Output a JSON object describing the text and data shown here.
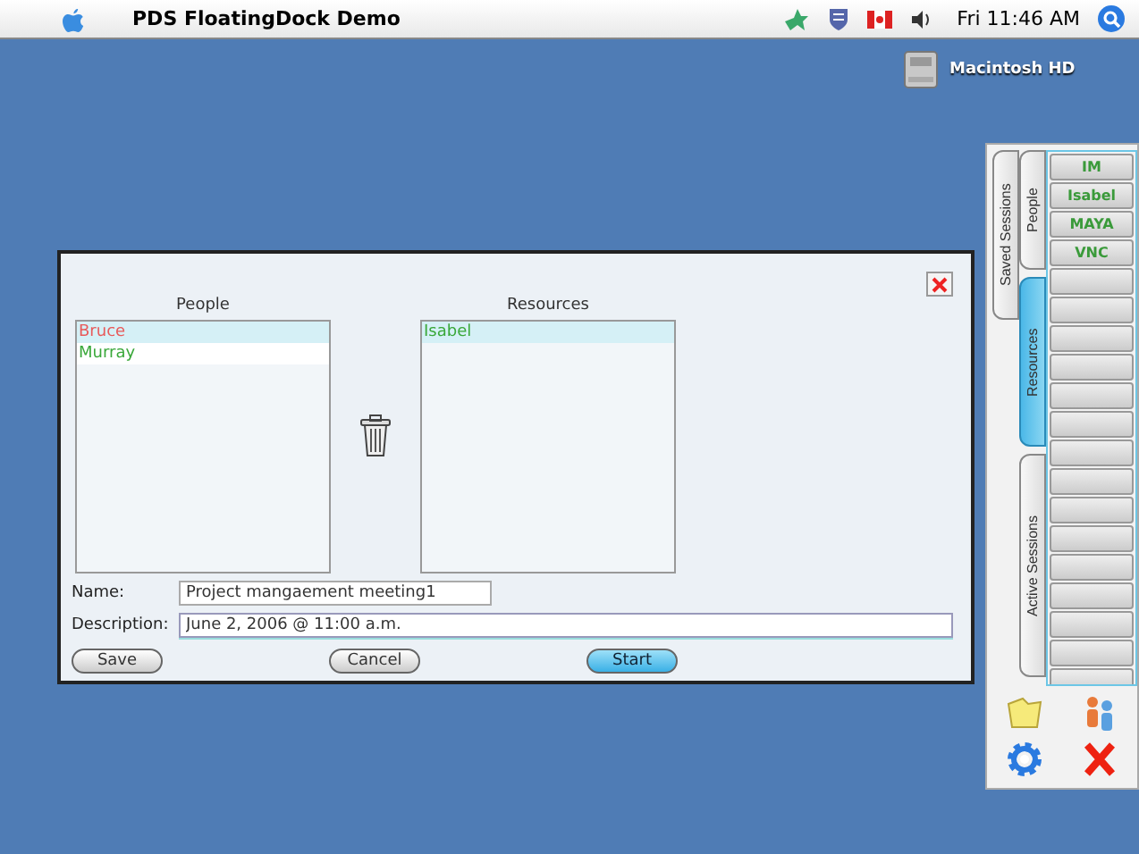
{
  "menu_bar": {
    "app_name": "PDS FloatingDock Demo",
    "clock": "Fri 11:46 AM"
  },
  "desktop_icons": [
    {
      "label": "Macintosh HD"
    }
  ],
  "dialog": {
    "lists": [
      {
        "title": "People",
        "items": [
          {
            "name": "Bruce",
            "selected": true,
            "color": "#e85a5a"
          },
          {
            "name": "Murray",
            "selected": false,
            "color": "#3aa83a"
          }
        ]
      },
      {
        "title": "Resources",
        "items": [
          {
            "name": "Isabel",
            "selected": true,
            "color": "#3aa83a"
          }
        ]
      }
    ],
    "fields": [
      {
        "label": "Name:",
        "value": "Project mangaement meeting1",
        "kind": "short"
      },
      {
        "label": "Description:",
        "value": "June 2, 2006 @ 11:00 a.m.",
        "kind": "long"
      }
    ],
    "buttons": [
      {
        "label": "Save",
        "kind": "normal"
      },
      {
        "label": "Cancel",
        "kind": "normal"
      },
      {
        "label": "Start",
        "kind": "default"
      }
    ]
  },
  "dock": {
    "outer_tabs": [
      {
        "label": "Saved Sessions",
        "selected": false
      }
    ],
    "tabs": [
      {
        "label": "People",
        "selected": false
      },
      {
        "label": "Resources",
        "selected": true
      },
      {
        "label": "Active Sessions",
        "selected": false
      }
    ],
    "slots": [
      "IM",
      "Isabel",
      "MAYA",
      "VNC"
    ]
  }
}
